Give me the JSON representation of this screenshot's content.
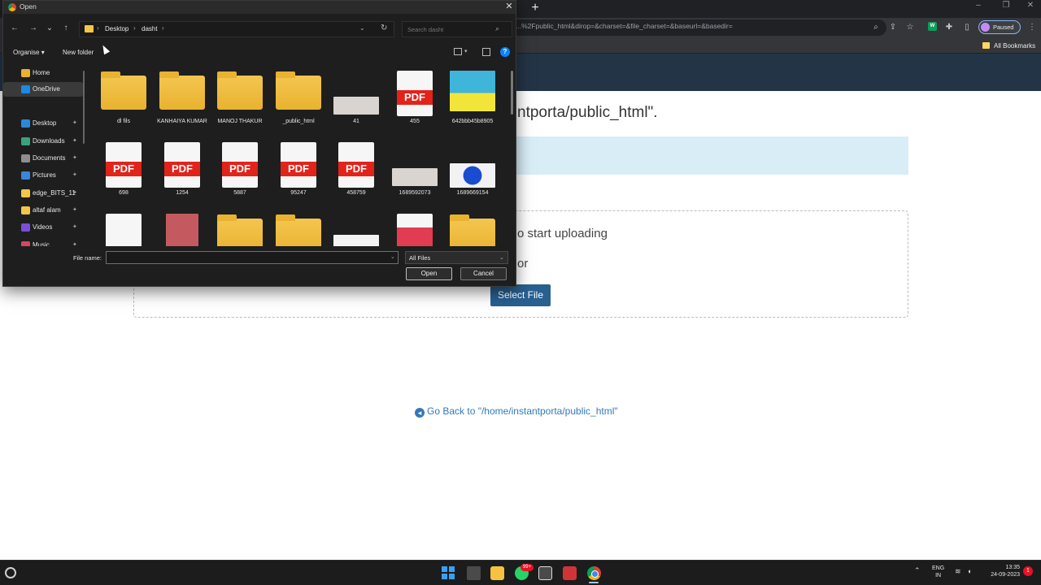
{
  "browser": {
    "url": "...%2Fpublic_html&dirop=&charset=&file_charset=&baseurl=&basedir=",
    "profile_label": "Paused",
    "bookmarks_label": "All Bookmarks",
    "new_tab": "+"
  },
  "page": {
    "heading": "ntporta/public_html\".",
    "drop_text": "o start uploading",
    "or_text": "or",
    "select_file": "Select File",
    "go_back": "Go Back to \"/home/instantporta/public_html\""
  },
  "dialog": {
    "title": "Open",
    "breadcrumb": [
      "Desktop",
      "dasht"
    ],
    "search_placeholder": "Search dasht",
    "organise": "Organise",
    "new_folder": "New folder",
    "nav_items": [
      {
        "label": "Home",
        "color": "#e9b230",
        "pinned": false,
        "selected": false
      },
      {
        "label": "OneDrive",
        "color": "#1e88e5",
        "pinned": false,
        "selected": true
      },
      {
        "label": "Desktop",
        "color": "#2b8ad8",
        "pinned": true,
        "selected": false
      },
      {
        "label": "Downloads",
        "color": "#3aa37a",
        "pinned": true,
        "selected": false
      },
      {
        "label": "Documents",
        "color": "#8e8e8e",
        "pinned": true,
        "selected": false
      },
      {
        "label": "Pictures",
        "color": "#3b86d7",
        "pinned": true,
        "selected": false
      },
      {
        "label": "edge_BITS_11",
        "color": "#f2c649",
        "pinned": true,
        "selected": false
      },
      {
        "label": "altaf alam",
        "color": "#f2c649",
        "pinned": true,
        "selected": false
      },
      {
        "label": "Videos",
        "color": "#7b4fd6",
        "pinned": true,
        "selected": false
      },
      {
        "label": "Music",
        "color": "#d6475b",
        "pinned": true,
        "selected": false
      }
    ],
    "files": [
      {
        "name": "dl fils",
        "kind": "folder"
      },
      {
        "name": "KANHAIYA KUMAR",
        "kind": "folder"
      },
      {
        "name": "MANOJ THAKUR",
        "kind": "folder"
      },
      {
        "name": "_public_html",
        "kind": "folder"
      },
      {
        "name": "41",
        "kind": "image"
      },
      {
        "name": "455",
        "kind": "pdf"
      },
      {
        "name": "642bbb45b8905",
        "kind": "photo"
      },
      {
        "name": "698",
        "kind": "pdf"
      },
      {
        "name": "1254",
        "kind": "pdf"
      },
      {
        "name": "5887",
        "kind": "pdf"
      },
      {
        "name": "95247",
        "kind": "pdf"
      },
      {
        "name": "458759",
        "kind": "pdf"
      },
      {
        "name": "1689592073",
        "kind": "image"
      },
      {
        "name": "1689669154",
        "kind": "image-blue"
      },
      {
        "name": "",
        "kind": "blank"
      },
      {
        "name": "",
        "kind": "image-card"
      },
      {
        "name": "",
        "kind": "folder"
      },
      {
        "name": "",
        "kind": "folder"
      },
      {
        "name": "",
        "kind": "image-doc"
      },
      {
        "name": "",
        "kind": "db"
      },
      {
        "name": "",
        "kind": "folder"
      }
    ],
    "file_name_label": "File name:",
    "file_name_value": "",
    "file_type": "All Files",
    "open_button": "Open",
    "cancel_button": "Cancel"
  },
  "taskbar": {
    "whatsapp_badge": "99+",
    "lang_line1": "ENG",
    "lang_line2": "IN",
    "time": "13:35",
    "date": "24-09-2023",
    "notifications": "1"
  }
}
